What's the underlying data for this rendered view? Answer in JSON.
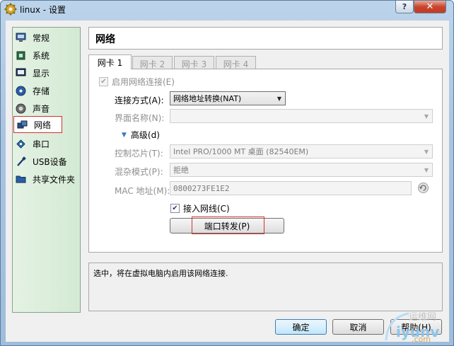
{
  "window": {
    "title": "linux - 设置",
    "help_label": "?",
    "close_label": "✕"
  },
  "sidebar": {
    "items": [
      {
        "label": "常规",
        "icon": "general-icon"
      },
      {
        "label": "系统",
        "icon": "system-icon"
      },
      {
        "label": "显示",
        "icon": "display-icon"
      },
      {
        "label": "存储",
        "icon": "storage-icon"
      },
      {
        "label": "声音",
        "icon": "audio-icon"
      },
      {
        "label": "网络",
        "icon": "network-icon",
        "selected": true
      },
      {
        "label": "串口",
        "icon": "serial-port-icon"
      },
      {
        "label": "USB设备",
        "icon": "usb-icon"
      },
      {
        "label": "共享文件夹",
        "icon": "shared-folder-icon"
      }
    ]
  },
  "page": {
    "title": "网络"
  },
  "tabs": [
    {
      "label": "网卡 1",
      "active": true
    },
    {
      "label": "网卡 2",
      "active": false
    },
    {
      "label": "网卡 3",
      "active": false
    },
    {
      "label": "网卡 4",
      "active": false
    }
  ],
  "form": {
    "enable_label": "启用网络连接(E)",
    "enable_checked": true,
    "attach_label": "连接方式(A):",
    "attach_value": "网络地址转换(NAT)",
    "name_label": "界面名称(N):",
    "name_value": "",
    "advanced_label": "高级(d)",
    "adapter_label": "控制芯片(T):",
    "adapter_value": "Intel PRO/1000 MT 桌面 (82540EM)",
    "promisc_label": "混杂模式(P):",
    "promisc_value": "拒绝",
    "mac_label": "MAC 地址(M):",
    "mac_value": "0800273FE1E2",
    "cable_label": "接入网线(C)",
    "cable_checked": true,
    "port_forward_label": "端口转发(P)"
  },
  "description": "选中，将在虚拟电脑内启用该网络连接.",
  "footer": {
    "ok_label": "确定",
    "cancel_label": "取消",
    "help_label": "帮助(H)"
  },
  "watermark": {
    "line1": "运维网",
    "line2": "iyunv",
    "line3": ".com"
  },
  "colors": {
    "highlight": "#d23232",
    "sidebar_bg": "#dcefdc",
    "accent": "#3c7fb1"
  }
}
